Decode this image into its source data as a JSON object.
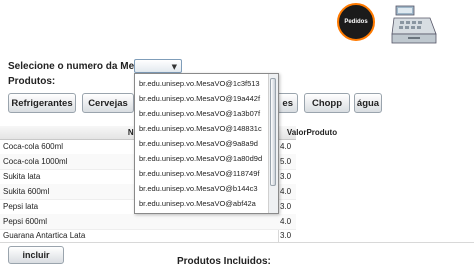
{
  "header": {
    "pedidos_label": "Pedidos",
    "pedidos_color": "#1b1b1b",
    "accent_color": "#ff7a00",
    "register_icon": "cash-register-icon"
  },
  "mesa": {
    "label": "Selecione o numero da Mesa:",
    "options": [
      "br.edu.unisep.vo.MesaVO@1c3f513",
      "br.edu.unisep.vo.MesaVO@19a442f",
      "br.edu.unisep.vo.MesaVO@1a3b07f",
      "br.edu.unisep.vo.MesaVO@148831c",
      "br.edu.unisep.vo.MesaVO@9a8a9d",
      "br.edu.unisep.vo.MesaVO@1a80d9d",
      "br.edu.unisep.vo.MesaVO@118749f",
      "br.edu.unisep.vo.MesaVO@b144c3",
      "br.edu.unisep.vo.MesaVO@abf42a"
    ]
  },
  "produtos": {
    "label": "Produtos:",
    "buttons": [
      "Refrigerantes",
      "Cervejas",
      "es",
      "Chopp",
      "água"
    ]
  },
  "table": {
    "headers": [
      "Nome",
      "ValorProduto"
    ],
    "rows": [
      [
        "Coca-cola 600ml",
        "4.0"
      ],
      [
        "Coca-cola 1000ml",
        "5.0"
      ],
      [
        "Sukita lata",
        "3.0"
      ],
      [
        "Sukita 600ml",
        "4.0"
      ],
      [
        "Pepsi lata",
        "3.0"
      ],
      [
        "Pepsi 600ml",
        "4.0"
      ],
      [
        "Guarana Antartica Lata",
        "3.0"
      ]
    ]
  },
  "footer": {
    "incluir_label": "incluir",
    "produtos_incluidos_label": "Produtos Incluidos:"
  }
}
